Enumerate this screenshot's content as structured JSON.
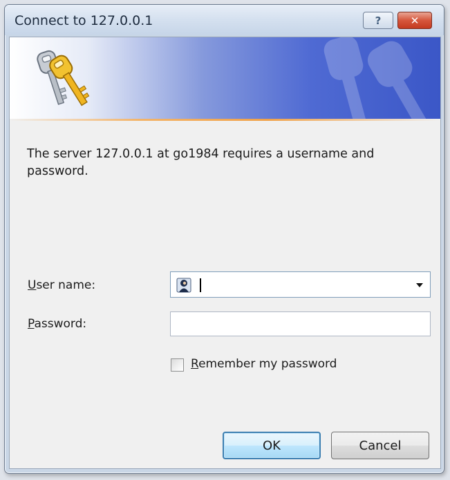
{
  "window": {
    "title": "Connect to 127.0.0.1",
    "help_label": "?",
    "close_label": "✕"
  },
  "message": "The server 127.0.0.1 at go1984 requires a username and password.",
  "username": {
    "label_accel": "U",
    "label_rest": "ser name:",
    "value": ""
  },
  "password": {
    "label_accel": "P",
    "label_rest": "assword:",
    "value": ""
  },
  "remember": {
    "label_accel": "R",
    "label_rest": "emember my password",
    "checked": false
  },
  "buttons": {
    "ok": "OK",
    "cancel": "Cancel"
  },
  "icons": {
    "banner": "keys-icon",
    "watermark": "keys-watermark-icon",
    "user_field": "user-icon"
  }
}
